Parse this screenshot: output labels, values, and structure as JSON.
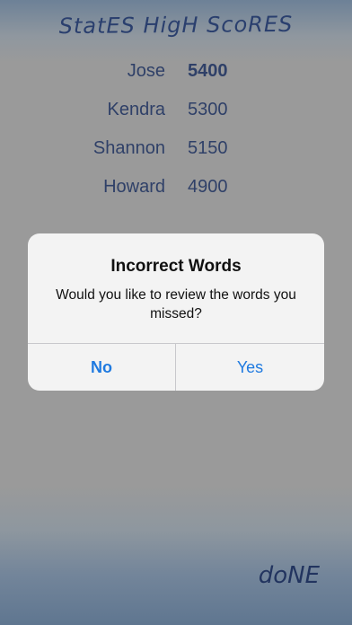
{
  "screen": {
    "title": "StatES HigH ScoRES",
    "done_label": "doNE"
  },
  "scores": [
    {
      "name": "Jose",
      "score": "5400"
    },
    {
      "name": "Kendra",
      "score": "5300"
    },
    {
      "name": "Shannon",
      "score": "5150"
    },
    {
      "name": "Howard",
      "score": "4900"
    }
  ],
  "alert": {
    "title": "Incorrect Words",
    "message": "Would you like to review the words you missed?",
    "no_label": "No",
    "yes_label": "Yes"
  },
  "colors": {
    "title_text": "#2a3f6e",
    "score_text": "#2f4068",
    "alert_button": "#1f7ae0",
    "background": "#9a9a9a"
  }
}
